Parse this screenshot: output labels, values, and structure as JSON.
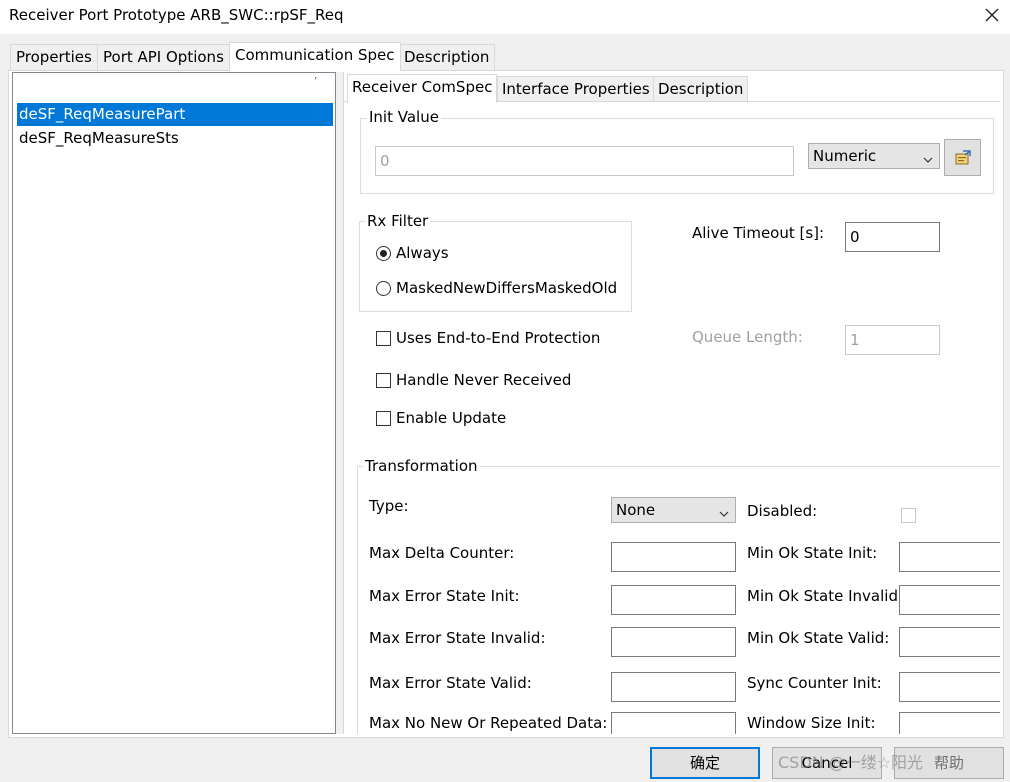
{
  "window": {
    "title": "Receiver Port Prototype ARB_SWC::rpSF_Req",
    "close_icon": "close-icon"
  },
  "outer_tabs": [
    {
      "label": "Properties",
      "active": false
    },
    {
      "label": "Port API Options",
      "active": false
    },
    {
      "label": "Communication Spec",
      "active": true
    },
    {
      "label": "Description",
      "active": false
    }
  ],
  "list": {
    "sort_mark": "’",
    "items": [
      {
        "label": "deSF_ReqMeasurePart",
        "selected": true
      },
      {
        "label": "deSF_ReqMeasureSts",
        "selected": false
      }
    ]
  },
  "inner_tabs": [
    {
      "label": "Receiver ComSpec",
      "active": true
    },
    {
      "label": "Interface Properties",
      "active": false
    },
    {
      "label": "Description",
      "active": false
    }
  ],
  "init_value": {
    "group_label": "Init Value",
    "value": "0",
    "type_selected": "Numeric",
    "edit_icon": "edit-icon"
  },
  "rx_filter": {
    "group_label": "Rx Filter",
    "options": [
      {
        "label": "Always",
        "checked": true
      },
      {
        "label": "MaskedNewDiffersMaskedOld",
        "checked": false
      }
    ]
  },
  "alive_timeout": {
    "label": "Alive Timeout [s]:",
    "value": "0"
  },
  "queue_length": {
    "label": "Queue Length:",
    "value": "1"
  },
  "checkboxes": [
    {
      "label": "Uses End-to-End Protection",
      "checked": false
    },
    {
      "label": "Handle Never Received",
      "checked": false
    },
    {
      "label": "Enable Update",
      "checked": false
    }
  ],
  "transformation": {
    "group_label": "Transformation",
    "type_label": "Type:",
    "type_selected": "None",
    "disabled_label": "Disabled:",
    "left_fields": [
      {
        "label": "Max Delta Counter:",
        "value": ""
      },
      {
        "label": "Max Error State Init:",
        "value": ""
      },
      {
        "label": "Max Error State Invalid:",
        "value": ""
      },
      {
        "label": "Max Error State Valid:",
        "value": ""
      },
      {
        "label": "Max No New Or Repeated Data:",
        "value": ""
      }
    ],
    "right_fields": [
      {
        "label": "Min Ok State Init:",
        "value": ""
      },
      {
        "label": "Min Ok State Invalid:",
        "value": ""
      },
      {
        "label": "Min Ok State Valid:",
        "value": ""
      },
      {
        "label": "Sync Counter Init:",
        "value": ""
      },
      {
        "label": "Window Size Init:",
        "value": ""
      }
    ]
  },
  "buttons": {
    "ok": "确定",
    "cancel": "Cancel",
    "help": "帮助"
  },
  "watermark": "CSDN @一缕☆阳光"
}
